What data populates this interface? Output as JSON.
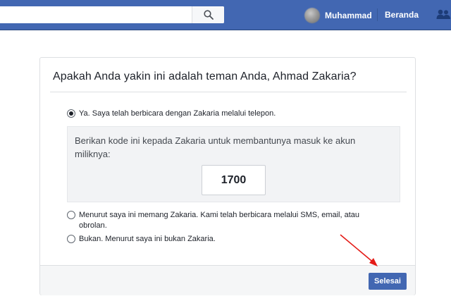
{
  "header": {
    "search_placeholder": "",
    "profile_name": "Muhammad",
    "home_label": "Beranda",
    "icons": [
      "search-icon",
      "friends-icon"
    ]
  },
  "dialog": {
    "title": "Apakah Anda yakin ini adalah teman Anda, Ahmad Zakaria?",
    "options": [
      {
        "label": "Ya. Saya telah berbicara dengan Zakaria melalui telepon.",
        "selected": true
      },
      {
        "label": "Menurut saya ini memang Zakaria. Kami telah berbicara melalui SMS, email, atau obrolan.",
        "selected": false
      },
      {
        "label": "Bukan. Menurut saya ini bukan Zakaria.",
        "selected": false
      }
    ],
    "code_instruction": "Berikan kode ini kepada Zakaria untuk membantunya masuk ke akun miliknya:",
    "code": "1700",
    "finish_label": "Selesai"
  },
  "colors": {
    "brand_blue": "#4267b2",
    "annotation_arrow": "#e41b17"
  }
}
